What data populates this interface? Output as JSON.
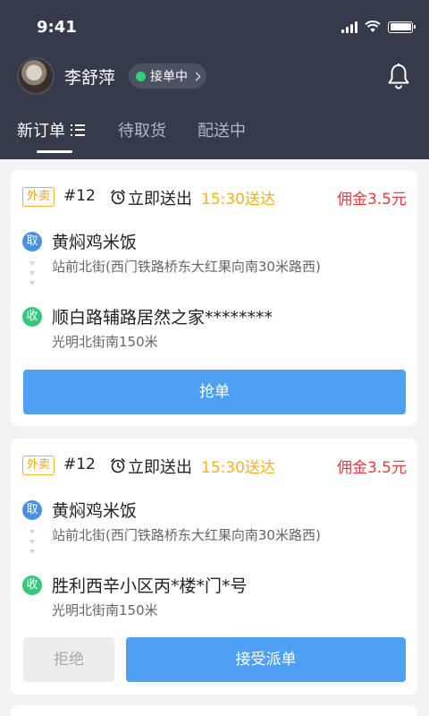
{
  "status_bar": {
    "time": "9:41",
    "battery_level": 1.0
  },
  "header": {
    "username": "李舒萍",
    "status": "接单中",
    "status_color": "#2fd27a",
    "background": "#363b4c"
  },
  "tabs": [
    {
      "label": "新订单",
      "active": true
    },
    {
      "label": "待取货",
      "active": false
    },
    {
      "label": "配送中",
      "active": false
    }
  ],
  "orders": [
    {
      "tag": "外卖",
      "order_no": "#12",
      "deliver_mode": "立即送出",
      "deliver_time": "15:30送达",
      "commission": "佣金3.5元",
      "pickup_badge": "取",
      "pickup_name": "黄焖鸡米饭",
      "pickup_address": "站前北街(西门铁路桥东大红果向南30米路西)",
      "dropoff_badge": "收",
      "dropoff_name": "顺白路辅路居然之家********",
      "dropoff_address": "光明北街南150米",
      "action_label": "抢单"
    },
    {
      "tag": "外卖",
      "order_no": "#12",
      "deliver_mode": "立即送出",
      "deliver_time": "15:30送达",
      "commission": "佣金3.5元",
      "pickup_badge": "取",
      "pickup_name": "黄焖鸡米饭",
      "pickup_address": "站前北街(西门铁路桥东大红果向南30米路西)",
      "dropoff_badge": "收",
      "dropoff_name": "胜利西辛小区丙*楼*门*号",
      "dropoff_address": "光明北街南150米",
      "reject_label": "拒绝",
      "accept_label": "接受派单"
    }
  ],
  "colors": {
    "accent": "#4ea0f5",
    "commission": "#f03a3a",
    "deliver_time": "#f2b21c",
    "pickup_badge": "#4a90e2",
    "dropoff_badge": "#35c77e"
  },
  "icons": [
    "signal-icon",
    "wifi-icon",
    "battery-icon",
    "bell-icon",
    "list-icon",
    "alarm-clock-icon",
    "chevron-right-icon"
  ]
}
